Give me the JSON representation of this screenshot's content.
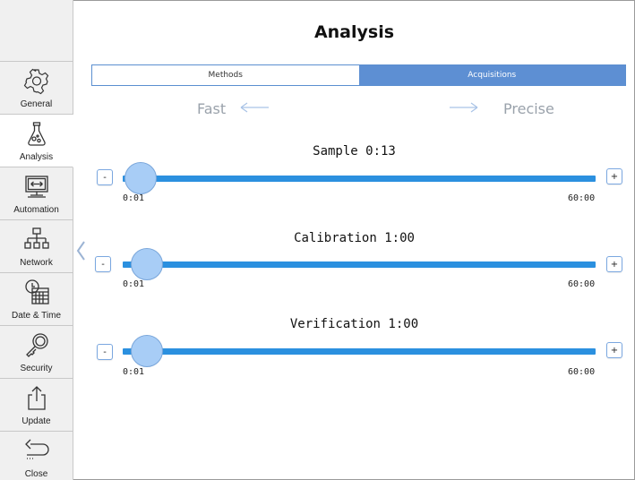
{
  "sidebar": {
    "items": [
      {
        "label": "General"
      },
      {
        "label": "Analysis"
      },
      {
        "label": "Automation"
      },
      {
        "label": "Network"
      },
      {
        "label": "Date & Time"
      },
      {
        "label": "Security"
      },
      {
        "label": "Update"
      },
      {
        "label": "Close"
      }
    ],
    "active": "Analysis"
  },
  "page": {
    "title": "Analysis"
  },
  "tabs": [
    {
      "label": "Methods",
      "active": false
    },
    {
      "label": "Acquisitions",
      "active": true
    }
  ],
  "hints": {
    "left": "Fast",
    "right": "Precise"
  },
  "sliders": [
    {
      "title": "Sample 0:13",
      "min_label": "0:01",
      "max_label": "60:00",
      "minus": "-",
      "plus": "+",
      "value_fraction": 0.004
    },
    {
      "title": "Calibration 1:00",
      "min_label": "0:01",
      "max_label": "60:00",
      "minus": "-",
      "plus": "+",
      "value_fraction": 0.017
    },
    {
      "title": "Verification 1:00",
      "min_label": "0:01",
      "max_label": "60:00",
      "minus": "-",
      "plus": "+",
      "value_fraction": 0.017
    }
  ],
  "colors": {
    "accent": "#5d8fd3",
    "track": "#2b90df",
    "thumb": "#a8cdf6",
    "hint": "#9aa2ab"
  }
}
